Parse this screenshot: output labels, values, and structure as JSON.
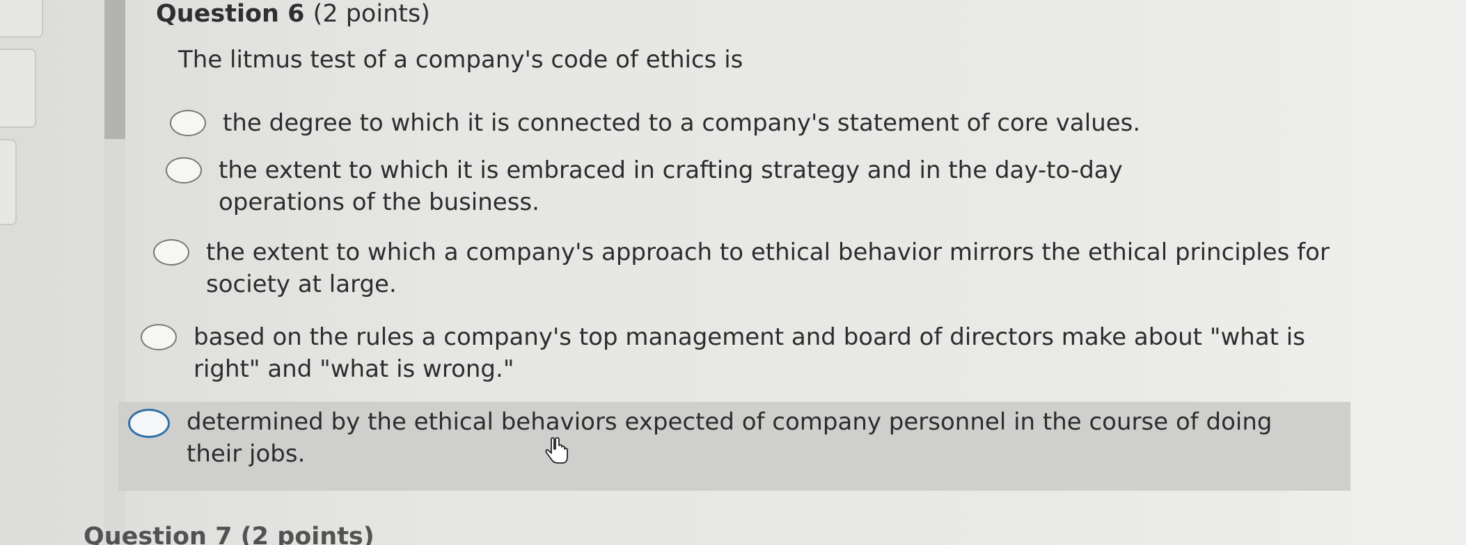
{
  "question": {
    "title": "Question 6",
    "points": "(2 points)",
    "prompt": "The litmus test of a company's code of ethics is"
  },
  "options": [
    {
      "label": "the degree to which it is connected to a company's statement of core values."
    },
    {
      "label": "the extent to which it is embraced in crafting strategy and in the day-to-day operations of the business."
    },
    {
      "label": "the extent to which a company's approach to ethical behavior mirrors the ethical principles for society at large."
    },
    {
      "label": "based on the rules a company's top management and board of directors make about \"what is right\" and \"what is wrong.\""
    },
    {
      "label": "determined by the ethical behaviors expected of company personnel in the course of doing their jobs."
    }
  ],
  "hovered_option_index": 4,
  "next_question": {
    "title_fragment": "Question 7 (2 points)"
  },
  "colors": {
    "hover_background": "#cfcfcd",
    "radio_focus": "#2f6fa8",
    "accent_bar": "#b3b3b1"
  },
  "icons": {
    "cursor": "hand-pointer-icon"
  }
}
